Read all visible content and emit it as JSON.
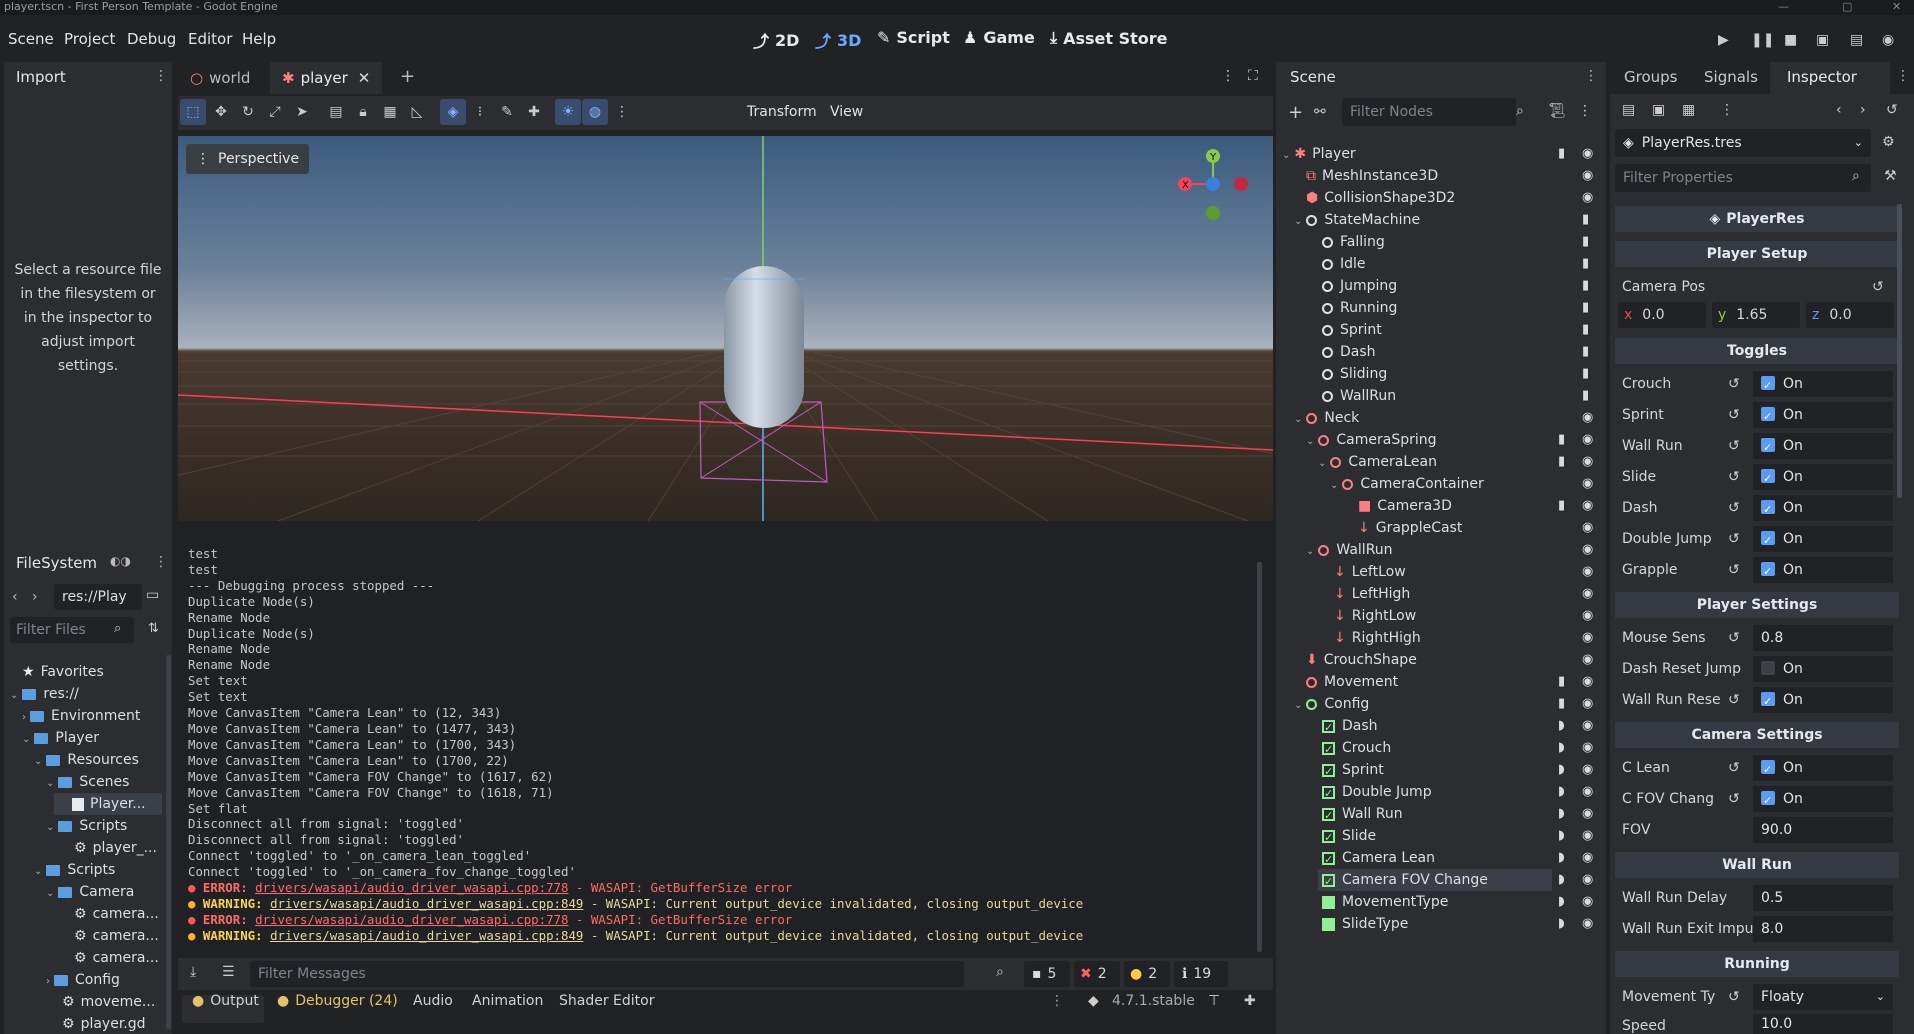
{
  "window": {
    "title": "player.tscn - First Person Template - Godot Engine"
  },
  "menu": [
    "Scene",
    "Project",
    "Debug",
    "Editor",
    "Help"
  ],
  "workspaces": {
    "w2d": "2D",
    "w3d": "3D",
    "script": "Script",
    "game": "Game",
    "asset_store": "Asset Store"
  },
  "import_panel": {
    "tab": "Import",
    "message": "Select a resource file in the filesystem or in the inspector to adjust import settings."
  },
  "filesystem": {
    "tab": "FileSystem",
    "path": "res://Play",
    "filter_placeholder": "Filter Files",
    "items": [
      {
        "label": "Favorites"
      },
      {
        "label": "res://"
      },
      {
        "label": "Environment"
      },
      {
        "label": "Player"
      },
      {
        "label": "Resources"
      },
      {
        "label": "Scenes"
      },
      {
        "label": "Player..."
      },
      {
        "label": "Scripts"
      },
      {
        "label": "player_..."
      },
      {
        "label": "Scripts"
      },
      {
        "label": "Camera"
      },
      {
        "label": "camera..."
      },
      {
        "label": "camera..."
      },
      {
        "label": "camera..."
      },
      {
        "label": "Config"
      },
      {
        "label": "moveme..."
      },
      {
        "label": "player.gd"
      }
    ]
  },
  "editor_tabs": [
    {
      "label": "world"
    },
    {
      "label": "player"
    }
  ],
  "viewport_toolbar": {
    "transform": "Transform",
    "view": "View",
    "perspective": "Perspective"
  },
  "output": {
    "lines": [
      "test",
      "test",
      "--- Debugging process stopped ---",
      "Duplicate Node(s)",
      "Rename Node",
      "Duplicate Node(s)",
      "Rename Node",
      "Rename Node",
      "Set text",
      "Set text",
      "Move CanvasItem \"Camera Lean\" to (12, 343)",
      "Move CanvasItem \"Camera Lean\" to (1477, 343)",
      "Move CanvasItem \"Camera Lean\" to (1700, 343)",
      "Move CanvasItem \"Camera Lean\" to (1700, 22)",
      "Move CanvasItem \"Camera FOV Change\" to (1617, 62)",
      "Move CanvasItem \"Camera FOV Change\" to (1618, 71)",
      "Set flat",
      "Disconnect all from signal: 'toggled'",
      "Disconnect all from signal: 'toggled'",
      "Connect 'toggled' to '_on_camera_lean_toggled'",
      "Connect 'toggled' to '_on_camera_fov_change_toggled'"
    ],
    "messages": [
      {
        "kind": "ERROR:",
        "link": "drivers/wasapi/audio_driver_wasapi.cpp:778",
        "text": " - WASAPI: GetBufferSize error"
      },
      {
        "kind": "WARNING:",
        "link": "drivers/wasapi/audio_driver_wasapi.cpp:849",
        "text": " - WASAPI: Current output_device invalidated, closing output_device"
      },
      {
        "kind": "ERROR:",
        "link": "drivers/wasapi/audio_driver_wasapi.cpp:778",
        "text": " - WASAPI: GetBufferSize error"
      },
      {
        "kind": "WARNING:",
        "link": "drivers/wasapi/audio_driver_wasapi.cpp:849",
        "text": " - WASAPI: Current output_device invalidated, closing output_device"
      }
    ],
    "filter_placeholder": "Filter Messages",
    "counts": {
      "messages": "5",
      "errors": "2",
      "warnings": "2",
      "info": "19"
    }
  },
  "bottom_tabs": {
    "output": "Output",
    "debugger": "Debugger (24)",
    "audio": "Audio",
    "animation": "Animation",
    "shader": "Shader Editor",
    "version": "4.7.1.stable"
  },
  "scene": {
    "tab": "Scene",
    "filter_placeholder": "Filter Nodes",
    "nodes": [
      {
        "label": "Player"
      },
      {
        "label": "MeshInstance3D"
      },
      {
        "label": "CollisionShape3D2"
      },
      {
        "label": "StateMachine"
      },
      {
        "label": "Falling"
      },
      {
        "label": "Idle"
      },
      {
        "label": "Jumping"
      },
      {
        "label": "Running"
      },
      {
        "label": "Sprint"
      },
      {
        "label": "Dash"
      },
      {
        "label": "Sliding"
      },
      {
        "label": "WallRun"
      },
      {
        "label": "Neck"
      },
      {
        "label": "CameraSpring"
      },
      {
        "label": "CameraLean"
      },
      {
        "label": "CameraContainer"
      },
      {
        "label": "Camera3D"
      },
      {
        "label": "GrappleCast"
      },
      {
        "label": "WallRun"
      },
      {
        "label": "LeftLow"
      },
      {
        "label": "LeftHigh"
      },
      {
        "label": "RightLow"
      },
      {
        "label": "RightHigh"
      },
      {
        "label": "CrouchShape"
      },
      {
        "label": "Movement"
      },
      {
        "label": "Config"
      },
      {
        "label": "Dash"
      },
      {
        "label": "Crouch"
      },
      {
        "label": "Sprint"
      },
      {
        "label": "Double Jump"
      },
      {
        "label": "Wall Run"
      },
      {
        "label": "Slide"
      },
      {
        "label": "Camera Lean"
      },
      {
        "label": "Camera FOV Change"
      },
      {
        "label": "MovementType"
      },
      {
        "label": "SlideType"
      }
    ]
  },
  "inspector": {
    "tabs": {
      "groups": "Groups",
      "signals": "Signals",
      "inspector": "Inspector"
    },
    "resource": "PlayerRes.tres",
    "filter_placeholder": "Filter Properties",
    "header": "PlayerRes",
    "sections": {
      "setup": "Player Setup",
      "toggles": "Toggles",
      "settings": "Player Settings",
      "camera": "Camera Settings",
      "wallrun": "Wall Run",
      "running": "Running"
    },
    "camera_pos": {
      "label": "Camera Pos",
      "x": "0.0",
      "y": "1.65",
      "z": "0.0"
    },
    "axis": {
      "x": "x",
      "y": "y",
      "z": "z"
    },
    "on": "On",
    "toggles": [
      {
        "label": "Crouch"
      },
      {
        "label": "Sprint"
      },
      {
        "label": "Wall Run"
      },
      {
        "label": "Slide"
      },
      {
        "label": "Dash"
      },
      {
        "label": "Double Jump"
      },
      {
        "label": "Grapple"
      }
    ],
    "settings": {
      "mouse_sens_label": "Mouse Sens",
      "mouse_sens": "0.8",
      "dash_reset_label": "Dash Reset Jump",
      "wall_run_reset_label": "Wall Run Rese"
    },
    "camera_settings": {
      "c_lean": "C Lean",
      "c_fov": "C FOV Chang",
      "fov_label": "FOV",
      "fov": "90.0"
    },
    "wall_run": {
      "delay_label": "Wall Run Delay",
      "delay": "0.5",
      "exit_label": "Wall Run Exit Impu",
      "exit": "8.0"
    },
    "running": {
      "movement_type_label": "Movement Ty",
      "movement_type": "Floaty",
      "speed_label": "Speed",
      "speed": "10.0"
    }
  }
}
